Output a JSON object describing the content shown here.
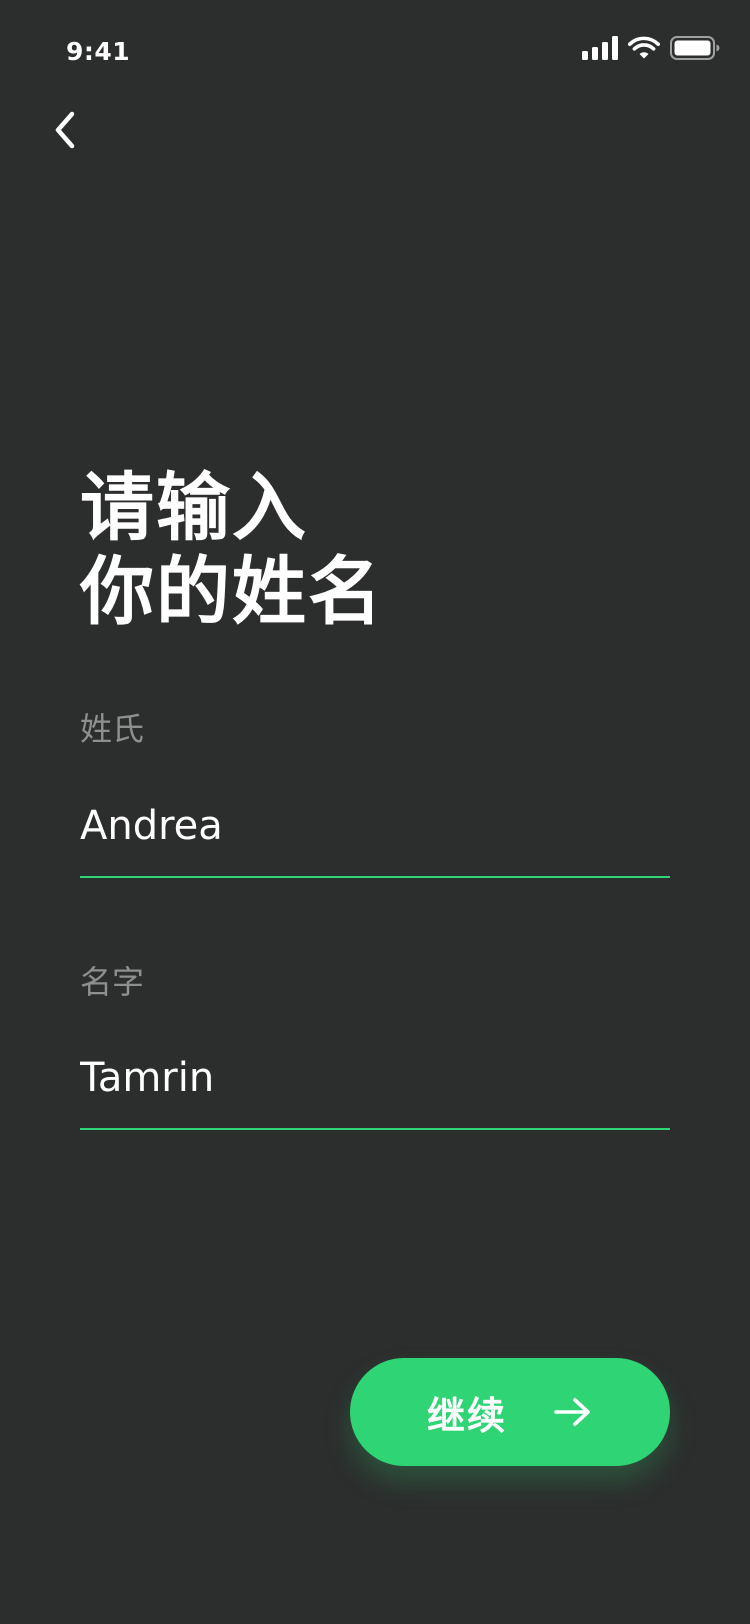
{
  "status_bar": {
    "time": "9:41",
    "icons": [
      "cellular-signal-icon",
      "wifi-icon",
      "battery-icon"
    ]
  },
  "nav": {
    "back_icon": "chevron-left-icon"
  },
  "title": {
    "line1": "请输入",
    "line2": "你的姓名"
  },
  "form": {
    "last_name": {
      "label": "姓氏",
      "value": "Andrea"
    },
    "first_name": {
      "label": "名字",
      "value": "Tamrin"
    }
  },
  "continue_button": {
    "label": "继续",
    "icon": "arrow-right-icon"
  },
  "colors": {
    "background": "#2c2d2d",
    "accent": "#2fd574",
    "text": "#ffffff",
    "label": "#8e8f8f"
  }
}
